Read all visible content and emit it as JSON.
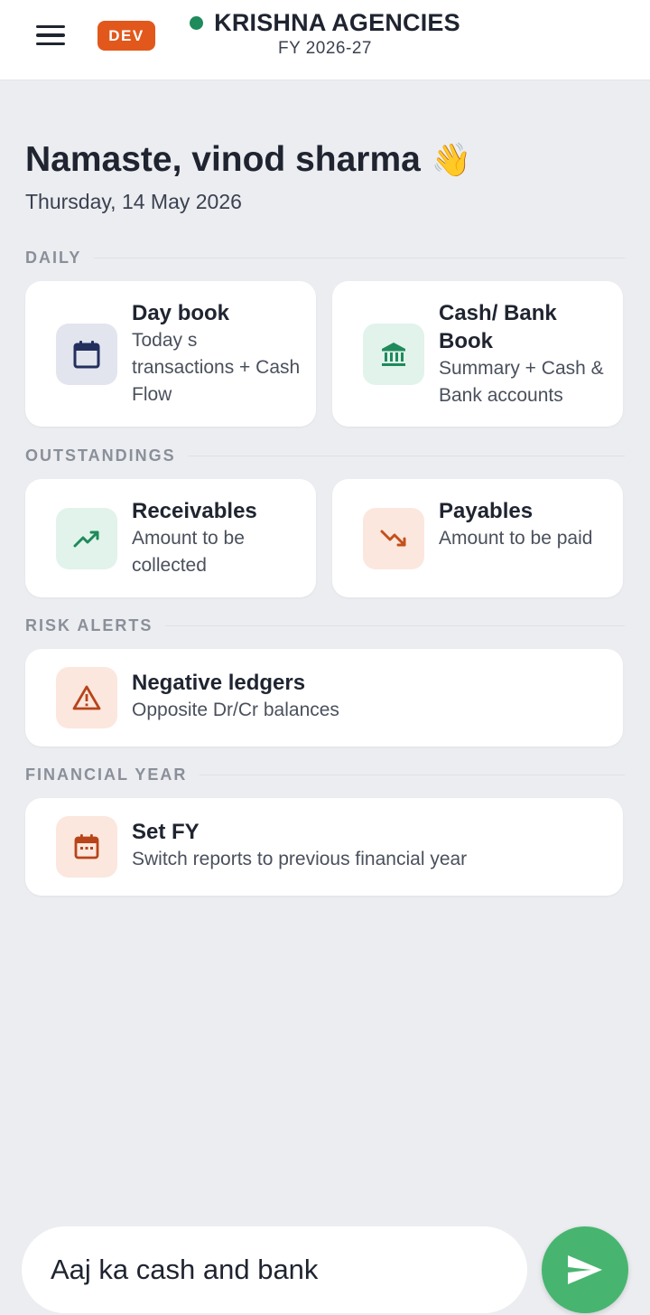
{
  "header": {
    "env_badge": "DEV",
    "company": "KRISHNA AGENCIES",
    "fy": "FY 2026-27",
    "status_color": "#1f8a5b"
  },
  "greeting": {
    "text": "Namaste, vinod sharma",
    "emoji": "👋",
    "date": "Thursday, 14 May 2026"
  },
  "sections": {
    "daily": "DAILY",
    "outstandings": "OUTSTANDINGS",
    "risk": "RISK ALERTS",
    "fy": "FINANCIAL YEAR"
  },
  "cards": {
    "daybook": {
      "title": "Day book",
      "desc": "Today s transactions + Cash Flow",
      "icon": "calendar-icon"
    },
    "cashbank": {
      "title": "Cash/ Bank Book",
      "desc": "Summary + Cash & Bank accounts",
      "icon": "bank-icon"
    },
    "receivables": {
      "title": "Receivables",
      "desc": "Amount to be collected",
      "icon": "trending-up-icon"
    },
    "payables": {
      "title": "Payables",
      "desc": "Amount to be paid",
      "icon": "trending-down-icon"
    },
    "negative": {
      "title": "Negative ledgers",
      "desc": "Opposite Dr/Cr balances",
      "icon": "warning-icon"
    },
    "setfy": {
      "title": "Set FY",
      "desc": "Switch reports to previous financial year",
      "icon": "calendar-month-icon"
    }
  },
  "chat": {
    "value": "Aaj ka cash and bank",
    "send_color": "#47b56f"
  },
  "colors": {
    "accent_orange": "#e2581c",
    "background": "#ebedf1"
  }
}
